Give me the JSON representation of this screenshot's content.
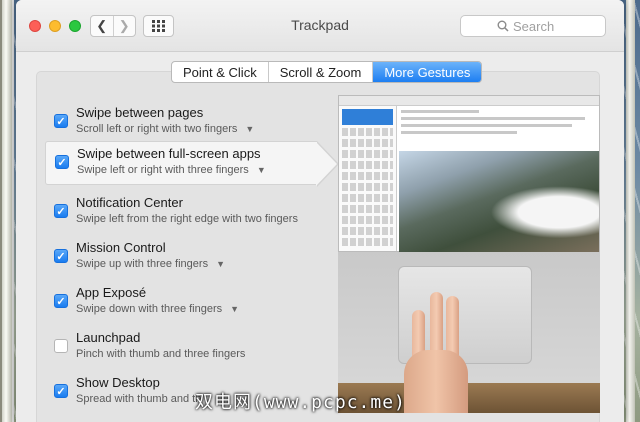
{
  "window": {
    "title": "Trackpad",
    "search_placeholder": "Search"
  },
  "icons": {
    "back": "chevron-left-icon",
    "forward": "chevron-right-icon",
    "show_all": "grid-icon",
    "search": "magnifier-icon",
    "checkmark": "checkmark-icon"
  },
  "colors": {
    "accent": "#1d7ef2",
    "close": "#fd5f57",
    "minimize": "#fdbc2e",
    "zoom": "#2ac840"
  },
  "tabs": [
    {
      "label": "Point & Click",
      "active": false
    },
    {
      "label": "Scroll & Zoom",
      "active": false
    },
    {
      "label": "More Gestures",
      "active": true
    }
  ],
  "gestures": [
    {
      "title": "Swipe between pages",
      "subtitle": "Scroll left or right with two fingers",
      "checked": true,
      "has_menu": true,
      "selected": false
    },
    {
      "title": "Swipe between full-screen apps",
      "subtitle": "Swipe left or right with three fingers",
      "checked": true,
      "has_menu": true,
      "selected": true
    },
    {
      "title": "Notification Center",
      "subtitle": "Swipe left from the right edge with two fingers",
      "checked": true,
      "has_menu": false,
      "selected": false
    },
    {
      "title": "Mission Control",
      "subtitle": "Swipe up with three fingers",
      "checked": true,
      "has_menu": true,
      "selected": false
    },
    {
      "title": "App Exposé",
      "subtitle": "Swipe down with three fingers",
      "checked": true,
      "has_menu": true,
      "selected": false
    },
    {
      "title": "Launchpad",
      "subtitle": "Pinch with thumb and three fingers",
      "checked": false,
      "has_menu": false,
      "selected": false
    },
    {
      "title": "Show Desktop",
      "subtitle": "Spread with thumb and th",
      "checked": true,
      "has_menu": false,
      "selected": false
    }
  ],
  "watermark": "双电网(www.pcpc.me)"
}
